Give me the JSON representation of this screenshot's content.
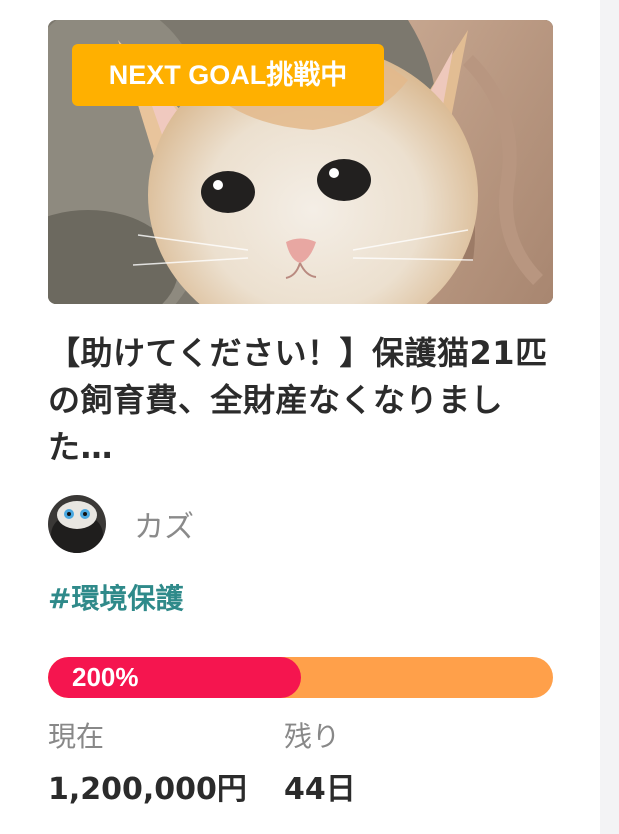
{
  "project": {
    "badge": "NEXT GOAL挑戦中",
    "title": "【助けてください！】保護猫21匹の飼育費、全財産なくなりました…",
    "author": "カズ",
    "tag": "#環境保護",
    "progress": {
      "label": "200%",
      "fill_fraction": 0.5
    },
    "stats": {
      "current_label": "現在",
      "current_value": "1,200,000円",
      "remaining_label": "残り",
      "remaining_value": "44日"
    }
  },
  "colors": {
    "badge": "#ffb000",
    "tag": "#2f8a8a",
    "progress_fill": "#f5154f",
    "progress_track": "#ffa04a"
  }
}
